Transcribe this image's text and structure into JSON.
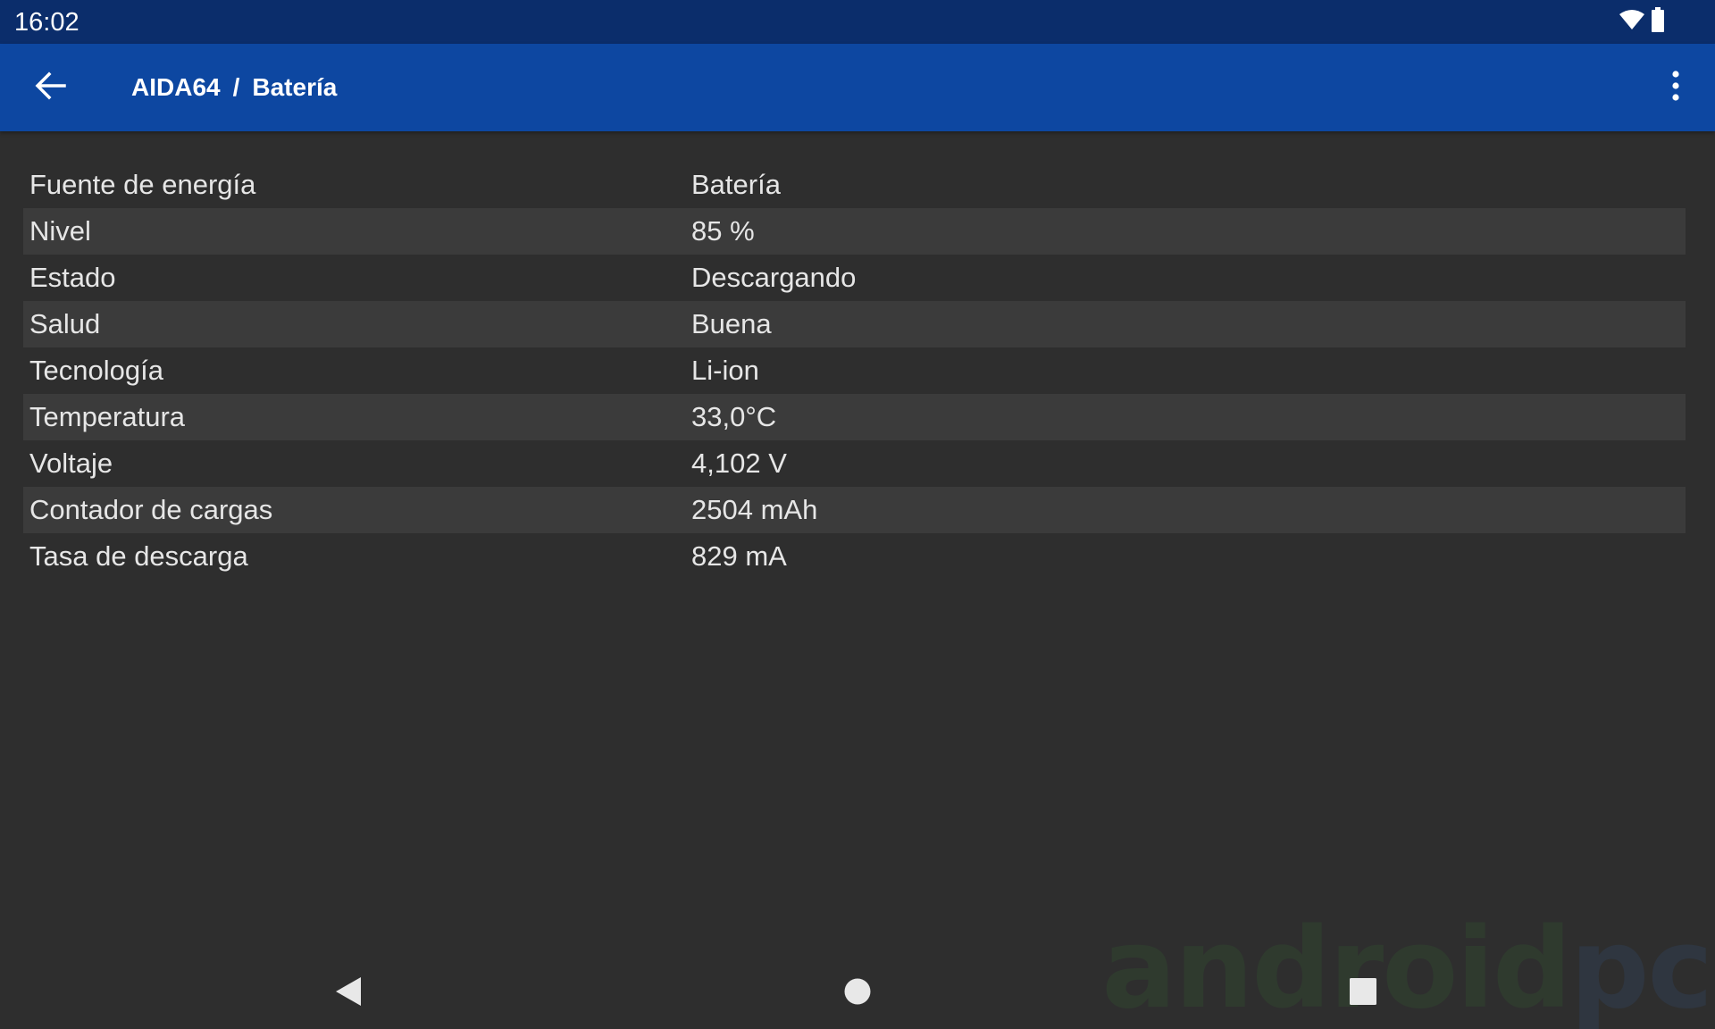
{
  "status_bar": {
    "time": "16:02",
    "icons": [
      "wifi-icon",
      "battery-icon"
    ]
  },
  "app_bar": {
    "back_icon": "arrow-back-icon",
    "breadcrumb": {
      "app": "AIDA64",
      "separator": "/",
      "page": "Batería"
    },
    "overflow_icon": "more-vert-icon"
  },
  "info": {
    "rows": [
      {
        "label": "Fuente de energía",
        "value": "Batería"
      },
      {
        "label": "Nivel",
        "value": "85 %"
      },
      {
        "label": "Estado",
        "value": "Descargando"
      },
      {
        "label": "Salud",
        "value": "Buena"
      },
      {
        "label": "Tecnología",
        "value": "Li-ion"
      },
      {
        "label": "Temperatura",
        "value": "33,0°C"
      },
      {
        "label": "Voltaje",
        "value": "4,102 V"
      },
      {
        "label": "Contador de cargas",
        "value": "2504 mAh"
      },
      {
        "label": "Tasa de descarga",
        "value": "829 mA"
      }
    ]
  },
  "nav_bar": {
    "icons": [
      "nav-back-icon",
      "nav-home-icon",
      "nav-recents-icon"
    ]
  },
  "watermark": {
    "part1": "android",
    "part2": "pc"
  },
  "colors": {
    "status_bar": "#0b2d6b",
    "app_bar": "#0d47a1",
    "background": "#2e2e2e",
    "row_alt": "#3b3b3b",
    "text": "#e6e6e6"
  }
}
